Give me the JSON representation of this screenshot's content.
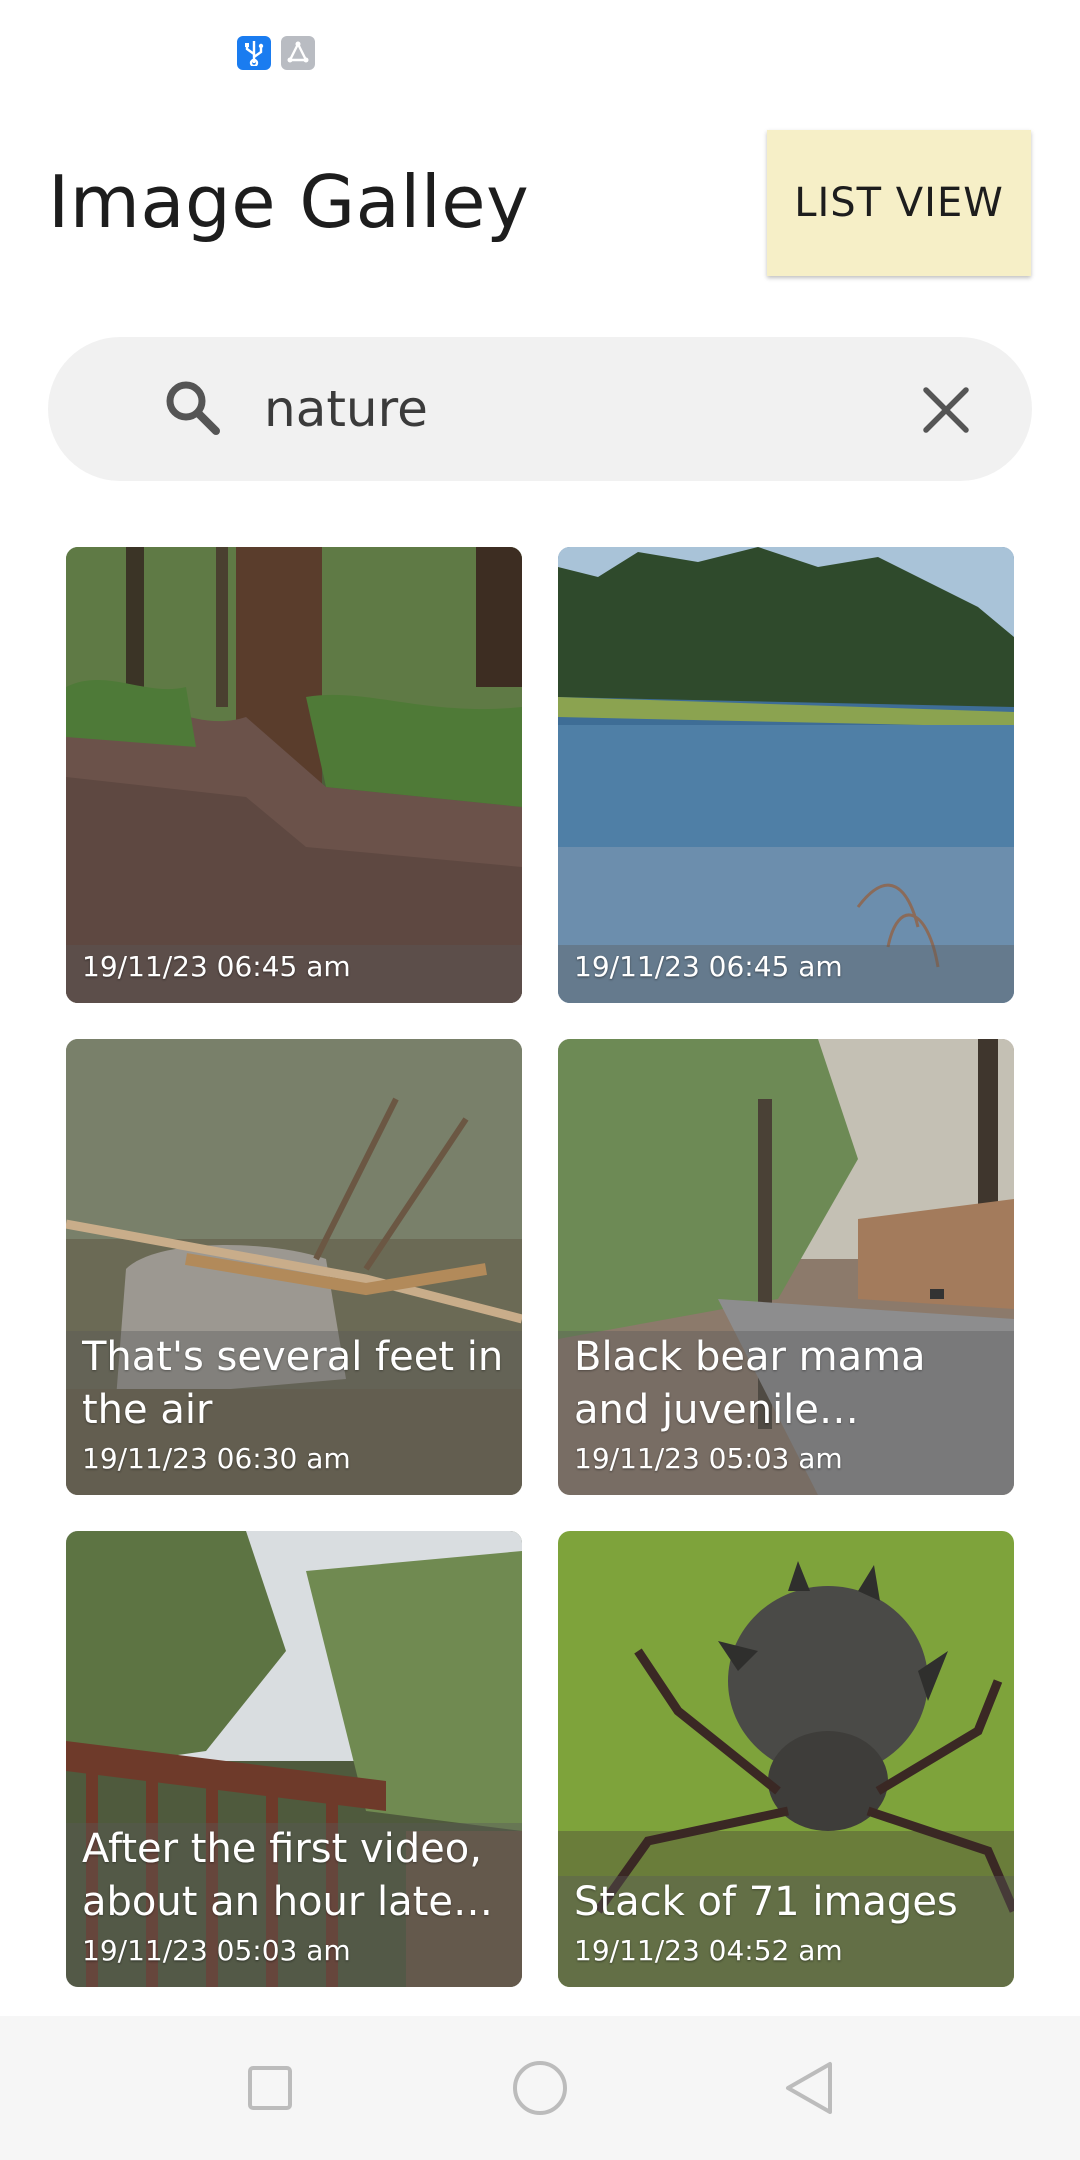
{
  "status_bar": {
    "icons": [
      "usb-icon",
      "share-icon"
    ],
    "colors": {
      "usb": "#1a7cf0",
      "share": "#b9bcc2"
    }
  },
  "header": {
    "title": "Image Galley",
    "list_view_label": "LIST VIEW",
    "button_color": "#f6efc7"
  },
  "search": {
    "value": "nature",
    "icon": "search-icon",
    "clear_icon": "close-icon"
  },
  "gallery": {
    "items": [
      {
        "caption": "",
        "timestamp": "19/11/23 06:45 am",
        "scene": "forest-trail"
      },
      {
        "caption": "",
        "timestamp": "19/11/23 06:45 am",
        "scene": "lake-shore"
      },
      {
        "caption": "That's several feet in the air",
        "timestamp": "19/11/23 06:30 am",
        "scene": "fallen-branch"
      },
      {
        "caption": "Black bear mama and juvenile walking…",
        "timestamp": "19/11/23 05:03 am",
        "scene": "woodland-road"
      },
      {
        "caption": "After the first video, about an hour later …",
        "timestamp": "19/11/23 05:03 am",
        "scene": "deck-garden"
      },
      {
        "caption": "Stack of 71 images",
        "timestamp": "19/11/23 04:52 am",
        "scene": "spider-macro"
      }
    ]
  },
  "nav_bar": {
    "icons": [
      "recent-apps-icon",
      "home-icon",
      "back-icon"
    ]
  }
}
